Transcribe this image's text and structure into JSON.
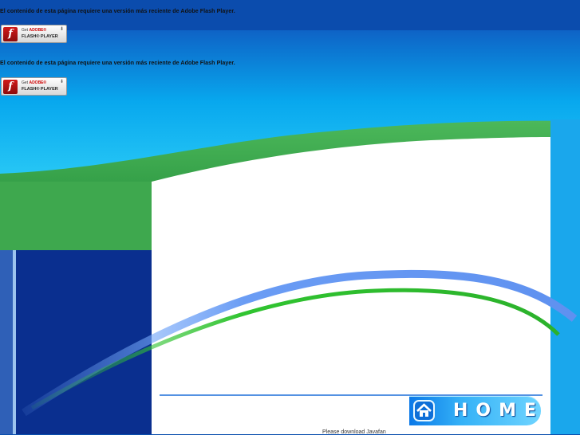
{
  "flash_notice": {
    "message": "El contenido de esta página requiere una versión más reciente de Adobe Flash Player.",
    "badge": {
      "get_label": "Get",
      "adobe_label": "ADOBE®",
      "product_label": "FLASH® PLAYER",
      "logo_glyph": "f"
    }
  },
  "nav": {
    "home_label": "HOME"
  },
  "footer": {
    "partial_text": "Please download Javafan"
  },
  "colors": {
    "top_blue": "#0a4fae",
    "sky_blue": "#1ab0ee",
    "band_green": "#3ea84e",
    "sidebar_navy": "#0a2f8f",
    "content_white": "#ffffff",
    "home_button": "#35b2f7"
  }
}
